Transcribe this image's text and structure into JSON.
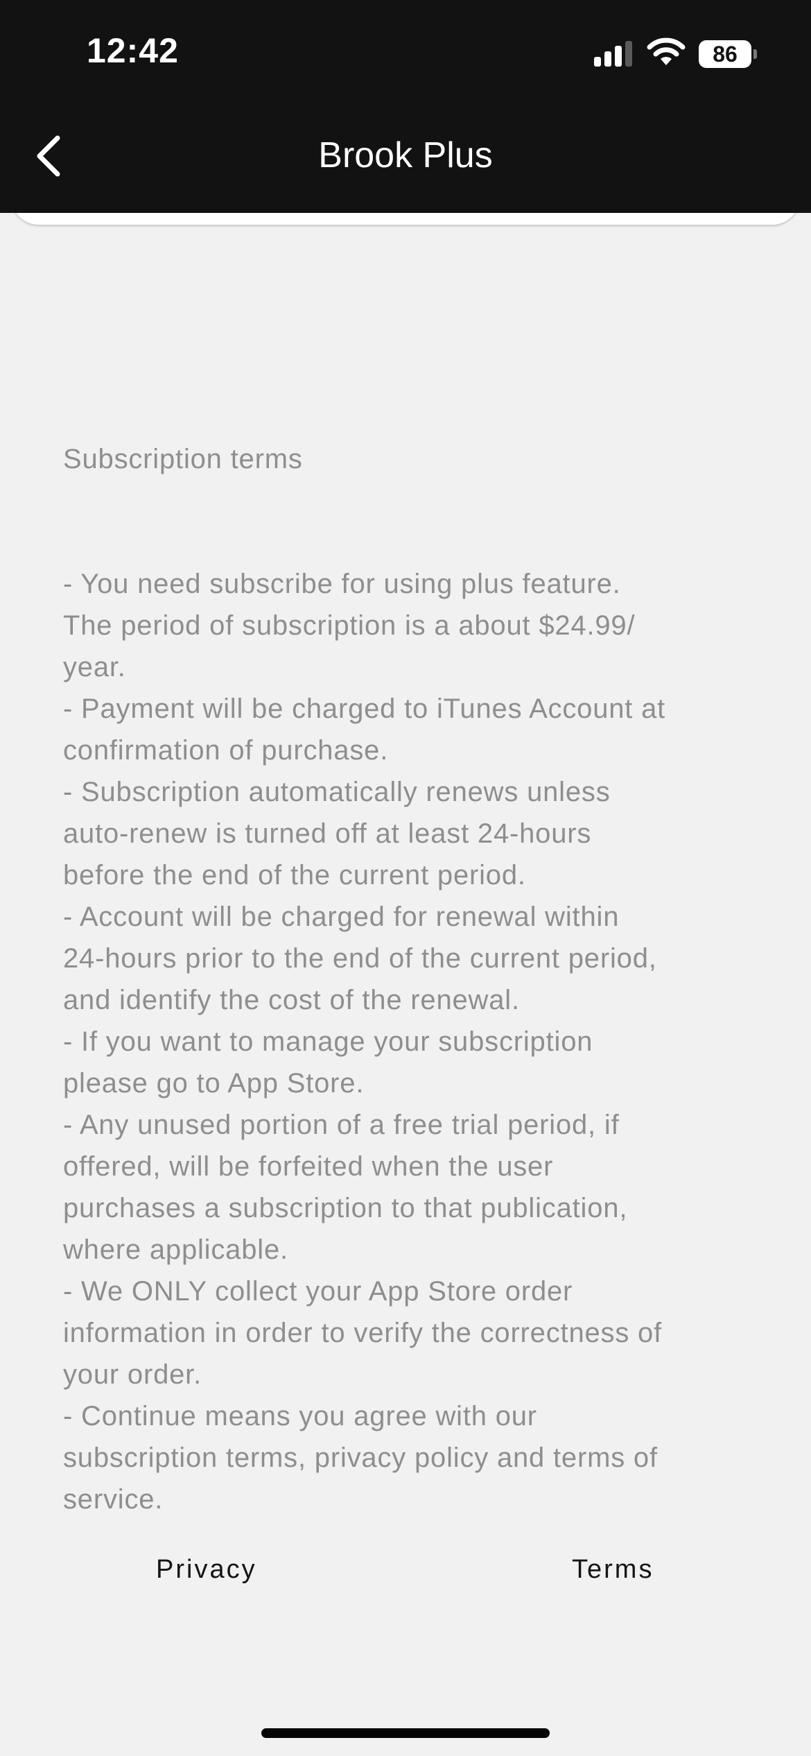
{
  "status_bar": {
    "time": "12:42",
    "battery_level": "86"
  },
  "nav": {
    "title": "Brook Plus",
    "back_icon": "chevron-left-icon"
  },
  "terms": {
    "heading": "Subscription terms",
    "body": "- You need subscribe for using plus feature.\nThe period of subscription is a about $24.99/\nyear.\n- Payment will be charged to iTunes Account at\nconfirmation of purchase.\n- Subscription automatically renews unless\nauto-renew is turned off at least 24-hours\nbefore the end of the current period.\n- Account will be charged for renewal within\n24-hours prior to the end of the current period,\nand identify the cost of the renewal.\n- If you want to manage your subscription\nplease go to App Store.\n- Any unused portion of a free trial period, if\noffered, will be forfeited when the user\npurchases a subscription to that publication,\nwhere applicable.\n- We ONLY collect your App Store order\ninformation in order to verify the correctness of\nyour order.\n- Continue means you agree with our\nsubscription terms, privacy policy and terms of\nservice."
  },
  "footer": {
    "privacy_label": "Privacy",
    "terms_label": "Terms"
  },
  "colors": {
    "bar_background": "#121212",
    "page_background": "#f1f1f1",
    "body_text": "#8e8e8e",
    "link_text": "#151515"
  }
}
